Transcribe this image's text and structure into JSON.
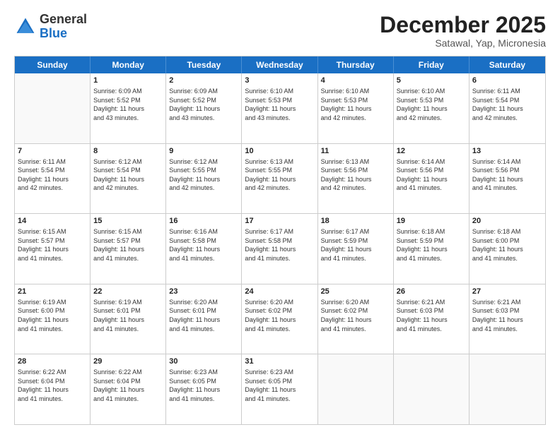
{
  "header": {
    "logo_general": "General",
    "logo_blue": "Blue",
    "month_title": "December 2025",
    "location": "Satawal, Yap, Micronesia"
  },
  "days_of_week": [
    "Sunday",
    "Monday",
    "Tuesday",
    "Wednesday",
    "Thursday",
    "Friday",
    "Saturday"
  ],
  "weeks": [
    [
      {
        "day": "",
        "info": ""
      },
      {
        "day": "1",
        "info": "Sunrise: 6:09 AM\nSunset: 5:52 PM\nDaylight: 11 hours\nand 43 minutes."
      },
      {
        "day": "2",
        "info": "Sunrise: 6:09 AM\nSunset: 5:52 PM\nDaylight: 11 hours\nand 43 minutes."
      },
      {
        "day": "3",
        "info": "Sunrise: 6:10 AM\nSunset: 5:53 PM\nDaylight: 11 hours\nand 43 minutes."
      },
      {
        "day": "4",
        "info": "Sunrise: 6:10 AM\nSunset: 5:53 PM\nDaylight: 11 hours\nand 42 minutes."
      },
      {
        "day": "5",
        "info": "Sunrise: 6:10 AM\nSunset: 5:53 PM\nDaylight: 11 hours\nand 42 minutes."
      },
      {
        "day": "6",
        "info": "Sunrise: 6:11 AM\nSunset: 5:54 PM\nDaylight: 11 hours\nand 42 minutes."
      }
    ],
    [
      {
        "day": "7",
        "info": "Sunrise: 6:11 AM\nSunset: 5:54 PM\nDaylight: 11 hours\nand 42 minutes."
      },
      {
        "day": "8",
        "info": "Sunrise: 6:12 AM\nSunset: 5:54 PM\nDaylight: 11 hours\nand 42 minutes."
      },
      {
        "day": "9",
        "info": "Sunrise: 6:12 AM\nSunset: 5:55 PM\nDaylight: 11 hours\nand 42 minutes."
      },
      {
        "day": "10",
        "info": "Sunrise: 6:13 AM\nSunset: 5:55 PM\nDaylight: 11 hours\nand 42 minutes."
      },
      {
        "day": "11",
        "info": "Sunrise: 6:13 AM\nSunset: 5:56 PM\nDaylight: 11 hours\nand 42 minutes."
      },
      {
        "day": "12",
        "info": "Sunrise: 6:14 AM\nSunset: 5:56 PM\nDaylight: 11 hours\nand 41 minutes."
      },
      {
        "day": "13",
        "info": "Sunrise: 6:14 AM\nSunset: 5:56 PM\nDaylight: 11 hours\nand 41 minutes."
      }
    ],
    [
      {
        "day": "14",
        "info": "Sunrise: 6:15 AM\nSunset: 5:57 PM\nDaylight: 11 hours\nand 41 minutes."
      },
      {
        "day": "15",
        "info": "Sunrise: 6:15 AM\nSunset: 5:57 PM\nDaylight: 11 hours\nand 41 minutes."
      },
      {
        "day": "16",
        "info": "Sunrise: 6:16 AM\nSunset: 5:58 PM\nDaylight: 11 hours\nand 41 minutes."
      },
      {
        "day": "17",
        "info": "Sunrise: 6:17 AM\nSunset: 5:58 PM\nDaylight: 11 hours\nand 41 minutes."
      },
      {
        "day": "18",
        "info": "Sunrise: 6:17 AM\nSunset: 5:59 PM\nDaylight: 11 hours\nand 41 minutes."
      },
      {
        "day": "19",
        "info": "Sunrise: 6:18 AM\nSunset: 5:59 PM\nDaylight: 11 hours\nand 41 minutes."
      },
      {
        "day": "20",
        "info": "Sunrise: 6:18 AM\nSunset: 6:00 PM\nDaylight: 11 hours\nand 41 minutes."
      }
    ],
    [
      {
        "day": "21",
        "info": "Sunrise: 6:19 AM\nSunset: 6:00 PM\nDaylight: 11 hours\nand 41 minutes."
      },
      {
        "day": "22",
        "info": "Sunrise: 6:19 AM\nSunset: 6:01 PM\nDaylight: 11 hours\nand 41 minutes."
      },
      {
        "day": "23",
        "info": "Sunrise: 6:20 AM\nSunset: 6:01 PM\nDaylight: 11 hours\nand 41 minutes."
      },
      {
        "day": "24",
        "info": "Sunrise: 6:20 AM\nSunset: 6:02 PM\nDaylight: 11 hours\nand 41 minutes."
      },
      {
        "day": "25",
        "info": "Sunrise: 6:20 AM\nSunset: 6:02 PM\nDaylight: 11 hours\nand 41 minutes."
      },
      {
        "day": "26",
        "info": "Sunrise: 6:21 AM\nSunset: 6:03 PM\nDaylight: 11 hours\nand 41 minutes."
      },
      {
        "day": "27",
        "info": "Sunrise: 6:21 AM\nSunset: 6:03 PM\nDaylight: 11 hours\nand 41 minutes."
      }
    ],
    [
      {
        "day": "28",
        "info": "Sunrise: 6:22 AM\nSunset: 6:04 PM\nDaylight: 11 hours\nand 41 minutes."
      },
      {
        "day": "29",
        "info": "Sunrise: 6:22 AM\nSunset: 6:04 PM\nDaylight: 11 hours\nand 41 minutes."
      },
      {
        "day": "30",
        "info": "Sunrise: 6:23 AM\nSunset: 6:05 PM\nDaylight: 11 hours\nand 41 minutes."
      },
      {
        "day": "31",
        "info": "Sunrise: 6:23 AM\nSunset: 6:05 PM\nDaylight: 11 hours\nand 41 minutes."
      },
      {
        "day": "",
        "info": ""
      },
      {
        "day": "",
        "info": ""
      },
      {
        "day": "",
        "info": ""
      }
    ]
  ]
}
